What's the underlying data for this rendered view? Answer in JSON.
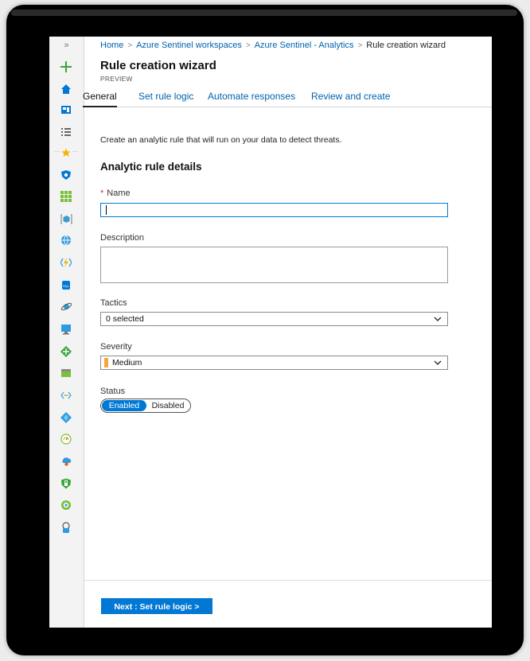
{
  "breadcrumb": {
    "items": [
      "Home",
      "Azure Sentinel workspaces",
      "Azure Sentinel - Analytics"
    ],
    "current": "Rule creation wizard",
    "separator": ">"
  },
  "page": {
    "title": "Rule creation wizard",
    "subtitle": "PREVIEW"
  },
  "tabs": [
    {
      "label": "General",
      "active": true
    },
    {
      "label": "Set rule logic",
      "active": false
    },
    {
      "label": "Automate responses",
      "active": false
    },
    {
      "label": "Review and create",
      "active": false
    }
  ],
  "form": {
    "intro": "Create an analytic rule that will run on your data to detect threats.",
    "heading": "Analytic rule details",
    "name_label": "Name",
    "name_required_marker": "*",
    "name_value": "",
    "description_label": "Description",
    "description_value": "",
    "tactics_label": "Tactics",
    "tactics_value": "0 selected",
    "severity_label": "Severity",
    "severity_value": "Medium",
    "severity_color": "#f7a63a",
    "status_label": "Status",
    "status_on": "Enabled",
    "status_off": "Disabled",
    "status_selected": "Enabled"
  },
  "footer": {
    "next_label": "Next : Set rule logic >"
  },
  "sidebar": {
    "expand_label": "»",
    "icons": [
      "create-resource-icon",
      "home-icon",
      "dashboard-icon",
      "all-services-icon",
      "favorites-star-icon",
      "sentinel-shield-icon",
      "apps-grid-icon",
      "resource-groups-icon",
      "globe-icon",
      "function-app-icon",
      "sql-database-icon",
      "cosmos-db-icon",
      "virtual-machine-icon",
      "load-balancer-icon",
      "storage-account-icon",
      "virtual-network-icon",
      "active-directory-icon",
      "monitor-icon",
      "advisor-icon",
      "security-center-icon",
      "cost-management-icon",
      "help-support-icon"
    ]
  },
  "colors": {
    "accent": "#0078d4",
    "link": "#0062ad",
    "required": "#cc3333"
  }
}
